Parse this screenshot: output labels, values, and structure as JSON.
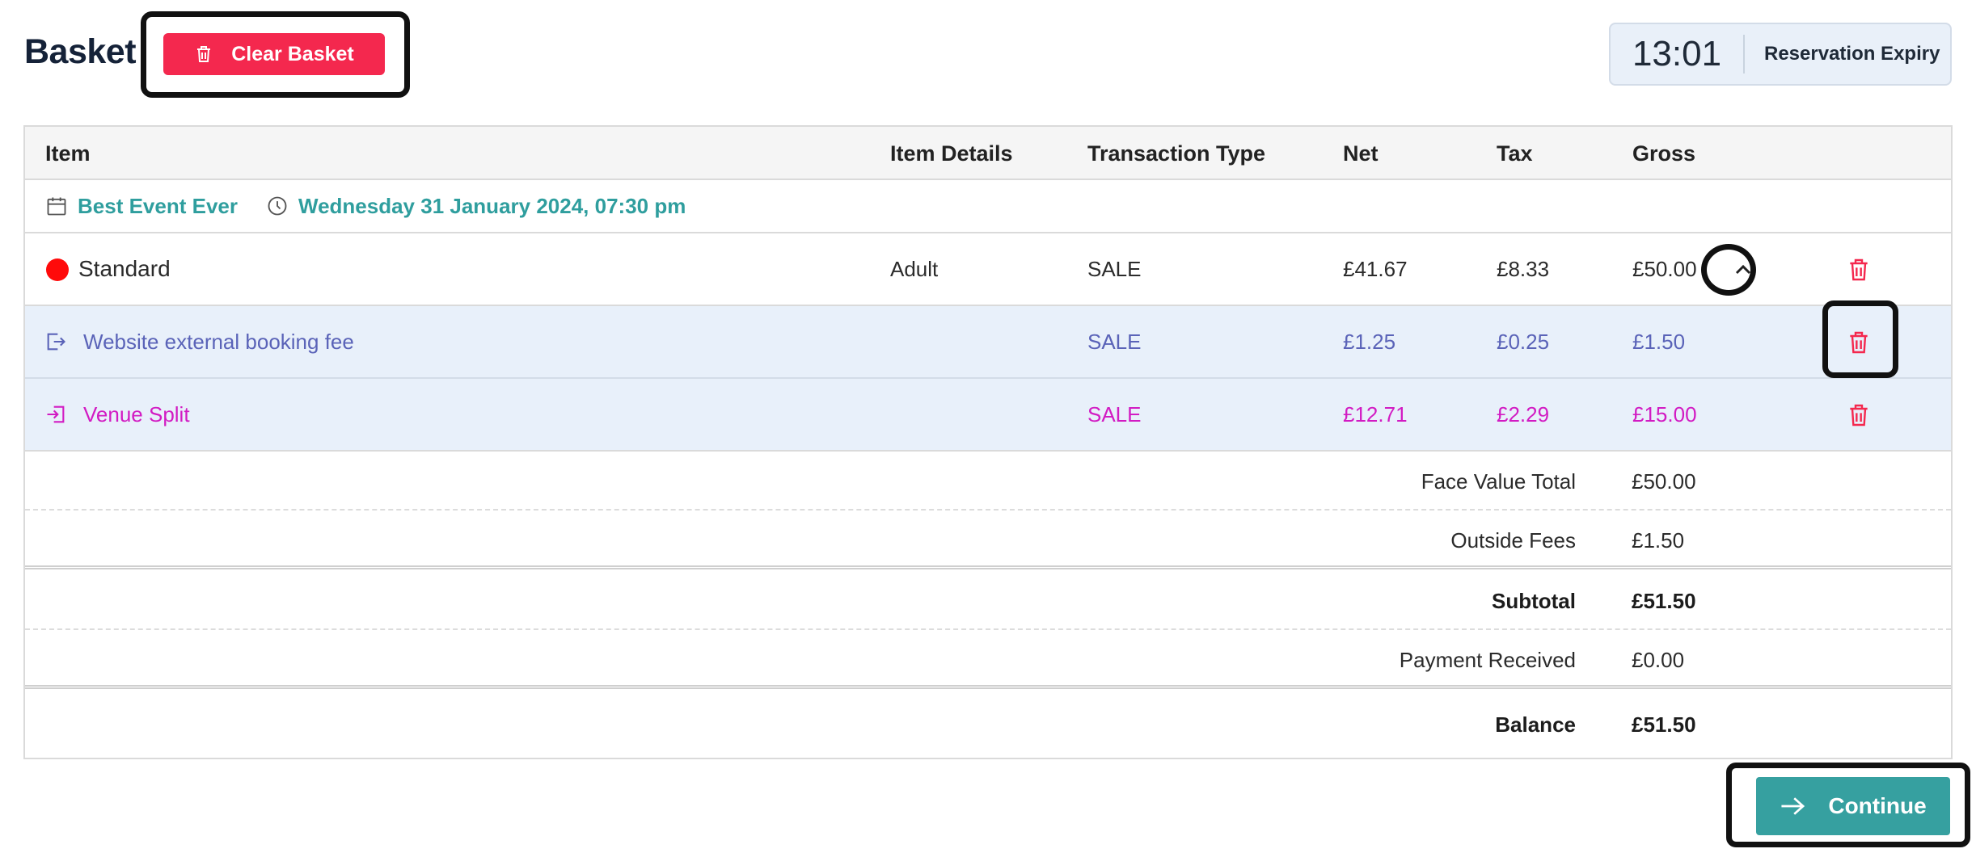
{
  "page": {
    "title": "Basket"
  },
  "toolbar": {
    "clear_label": "Clear Basket"
  },
  "timer": {
    "value": "13:01",
    "label": "Reservation Expiry"
  },
  "table": {
    "headers": [
      "Item",
      "Item Details",
      "Transaction Type",
      "Net",
      "Tax",
      "Gross"
    ],
    "event": {
      "name": "Best Event Ever",
      "datetime": "Wednesday 31 January 2024, 07:30 pm"
    },
    "rows": [
      {
        "name": "Standard",
        "details": "Adult",
        "type": "SALE",
        "net": "£41.67",
        "tax": "£8.33",
        "gross": "£50.00",
        "color": "#ff0a0a"
      },
      {
        "name": "Website external booking fee",
        "details": "",
        "type": "SALE",
        "net": "£1.25",
        "tax": "£0.25",
        "gross": "£1.50",
        "color": "#5a63b8"
      },
      {
        "name": "Venue Split",
        "details": "",
        "type": "SALE",
        "net": "£12.71",
        "tax": "£2.29",
        "gross": "£15.00",
        "color": "#d21bc3"
      }
    ]
  },
  "summary": [
    {
      "label": "Face Value Total",
      "value": "£50.00"
    },
    {
      "label": "Outside Fees",
      "value": "£1.50"
    },
    {
      "label": "Subtotal",
      "value": "£51.50"
    },
    {
      "label": "Payment Received",
      "value": "£0.00"
    },
    {
      "label": "Balance",
      "value": "£51.50"
    }
  ],
  "actions": {
    "continue_label": "Continue"
  },
  "colors": {
    "danger": "#f4284e",
    "accent": "#36a0a0",
    "event": "#2f9e9e"
  }
}
